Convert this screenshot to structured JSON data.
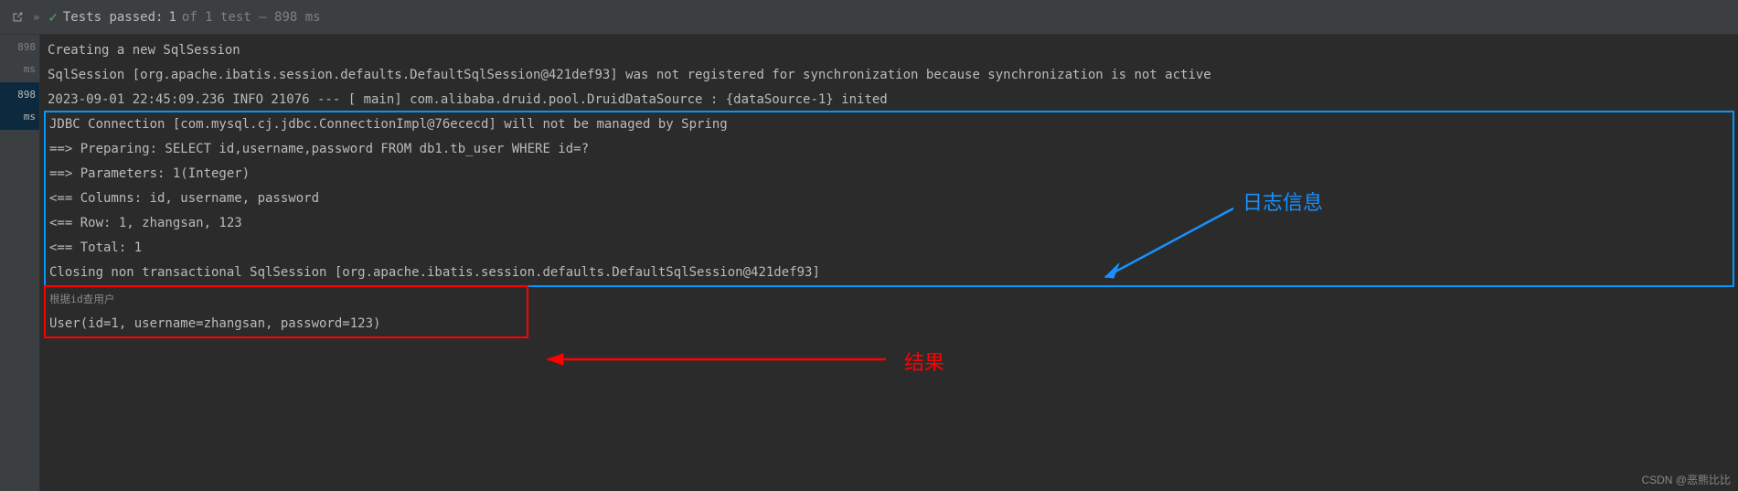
{
  "toolbar": {
    "tests_label": "Tests passed:",
    "tests_count": "1",
    "tests_detail": "of 1 test – 898 ms"
  },
  "sidebar": {
    "times": [
      "898 ms",
      "898 ms"
    ]
  },
  "console": {
    "line1": "Creating a new SqlSession",
    "line2": "SqlSession [org.apache.ibatis.session.defaults.DefaultSqlSession@421def93] was not registered for synchronization because synchronization is not active",
    "line3": "2023-09-01 22:45:09.236  INFO 21076 --- [           main] com.alibaba.druid.pool.DruidDataSource   : {dataSource-1} inited",
    "box1_line1": "JDBC Connection [com.mysql.cj.jdbc.ConnectionImpl@76ececd] will not be managed by Spring",
    "box1_line2": "==>  Preparing: SELECT id,username,password FROM db1.tb_user WHERE id=?",
    "box1_line3": "==> Parameters: 1(Integer)",
    "box1_line4": "<==    Columns: id, username, password",
    "box1_line5": "<==        Row: 1, zhangsan, 123",
    "box1_line6": "<==      Total: 1",
    "box1_line7": "Closing non transactional SqlSession [org.apache.ibatis.session.defaults.DefaultSqlSession@421def93]",
    "box2_line1": "根据id查用户",
    "box2_line2": "User(id=1, username=zhangsan, password=123)"
  },
  "annotations": {
    "log_info": "日志信息",
    "result": "结果"
  },
  "watermark": "CSDN @恶熊比比"
}
